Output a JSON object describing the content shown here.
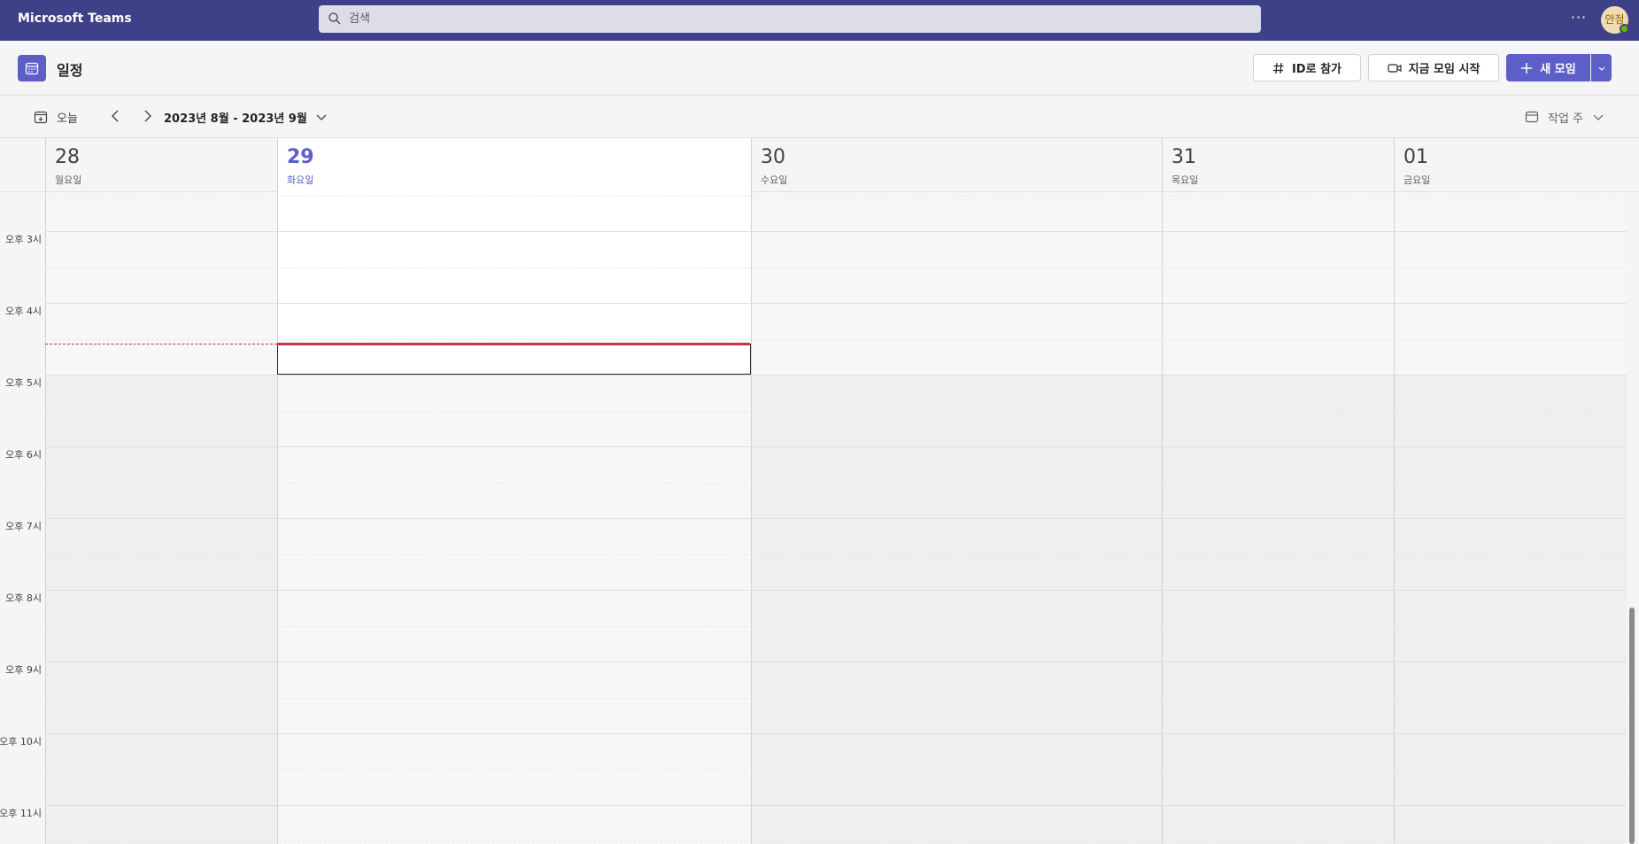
{
  "app": {
    "title": "Microsoft Teams"
  },
  "search": {
    "placeholder": "검색"
  },
  "topbar": {
    "more_label": "···",
    "avatar_initials": "안정"
  },
  "header": {
    "page_title": "일정",
    "join_id_label": "ID로 참가",
    "meet_now_label": "지금 모임 시작",
    "new_meeting_label": "새 모임"
  },
  "toolbar": {
    "today_label": "오늘",
    "range_label": "2023년 8월 - 2023년 9월",
    "view_label": "작업 주"
  },
  "days": [
    {
      "num": "28",
      "name": "월요일",
      "today": false
    },
    {
      "num": "29",
      "name": "화요일",
      "today": true
    },
    {
      "num": "30",
      "name": "수요일",
      "today": false
    },
    {
      "num": "31",
      "name": "목요일",
      "today": false
    },
    {
      "num": "01",
      "name": "금요일",
      "today": false
    }
  ],
  "time_labels": [
    "오후 3시",
    "오후 4시",
    "오후 5시",
    "오후 6시",
    "오후 7시",
    "오후 8시",
    "오후 9시",
    "오후 10시",
    "오후 11시"
  ],
  "colors": {
    "brand": "#5b5fc7",
    "topbar": "#3f4188",
    "now_line": "#c4314b"
  }
}
